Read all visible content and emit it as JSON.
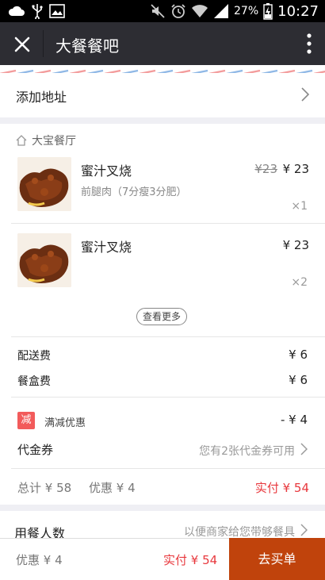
{
  "status_bar": {
    "battery": "27%",
    "time": "10:27"
  },
  "title_bar": {
    "title": "大餐餐吧"
  },
  "address": {
    "label": "添加地址"
  },
  "order": {
    "restaurant": "大宝餐厅",
    "items": [
      {
        "name": "蜜汁叉烧",
        "subtitle": "前腿肉（7分瘦3分肥）",
        "original_price": "¥23",
        "price": "¥ 23",
        "quantity": "×1"
      },
      {
        "name": "蜜汁叉烧",
        "subtitle": "",
        "original_price": "",
        "price": "¥ 23",
        "quantity": "×2"
      }
    ],
    "see_more": "查看更多",
    "fees": [
      {
        "label": "配送费",
        "value": "¥ 6"
      },
      {
        "label": "餐盒费",
        "value": "¥ 6"
      }
    ],
    "promo": {
      "badge": "减",
      "label": "满减优惠",
      "value": "- ¥ 4"
    },
    "voucher": {
      "label": "代金券",
      "hint": "您有2张代金券可用"
    },
    "summary": {
      "total": "总计 ¥ 58",
      "discount": "优惠 ¥ 4",
      "paid": "实付 ¥ 54"
    }
  },
  "diners": {
    "label": "用餐人数",
    "hint": "以便商家给您带够餐具"
  },
  "bottom_bar": {
    "discount": "优惠 ¥ 4",
    "paid": "实付 ¥ 54",
    "checkout": "去买单"
  },
  "colors": {
    "title_bar": "#2d2d33",
    "checkout": "#c0430c",
    "paid_text": "#e8383d",
    "promo_badge": "#f25b5b"
  }
}
